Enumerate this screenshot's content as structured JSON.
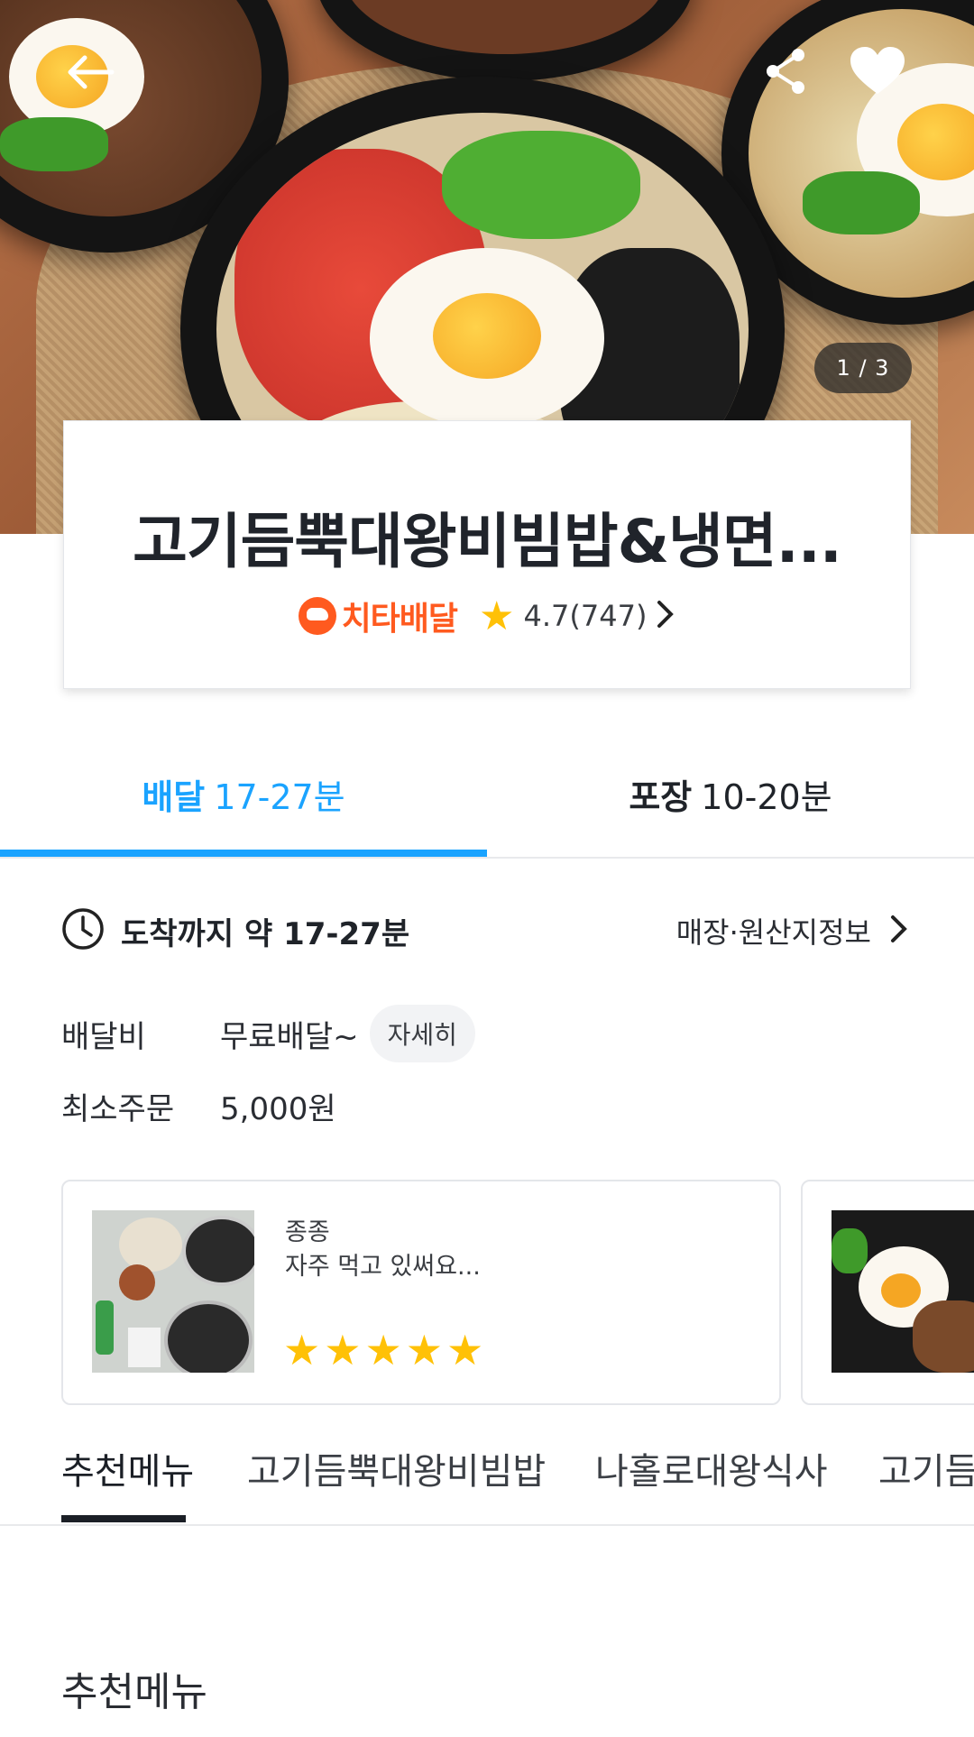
{
  "hero": {
    "pager": "1 / 3",
    "icons": {
      "back": "back-arrow-icon",
      "share": "share-icon",
      "favorite": "heart-icon"
    }
  },
  "store": {
    "name": "고기듬뿍대왕비빔밥&냉면...",
    "brand": "치타배달",
    "rating": "4.7(747)"
  },
  "order_tabs": [
    {
      "label": "배달",
      "time": "17-27분",
      "active": true
    },
    {
      "label": "포장",
      "time": "10-20분",
      "active": false
    }
  ],
  "delivery_info": {
    "arrival_text": "도착까지 약 17-27분",
    "store_info_link": "매장·원산지정보",
    "fee_label": "배달비",
    "fee_value": "무료배달~",
    "detail_button": "자세히",
    "min_order_label": "최소주문",
    "min_order_value": "5,000원"
  },
  "reviews": [
    {
      "text_line1": "종종",
      "text_line2": "자주 먹고 있써요...",
      "stars": 5
    }
  ],
  "menu_tabs": [
    "추천메뉴",
    "고기듬뿍대왕비빔밥",
    "나홀로대왕식사",
    "고기듬"
  ],
  "section_title": "추천메뉴",
  "colors": {
    "accent_blue": "#1aa3ff",
    "brand_orange": "#ff5a1f",
    "star": "#ffc107",
    "text_dark": "#1f2329"
  }
}
